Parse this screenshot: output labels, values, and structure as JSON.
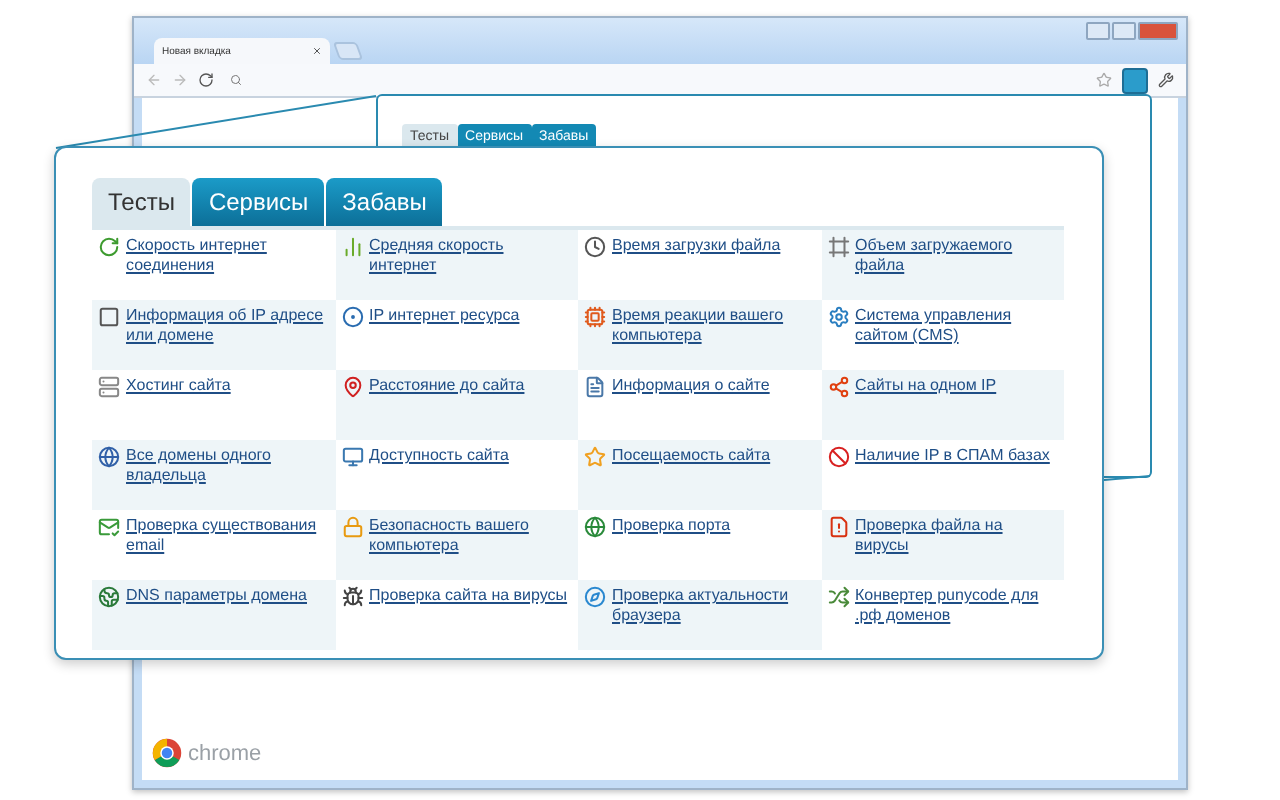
{
  "browser": {
    "tab_title": "Новая вкладка",
    "brand": "chrome"
  },
  "popup_preview": {
    "tabs": [
      {
        "label": "Тесты",
        "selected": true
      },
      {
        "label": "Сервисы",
        "selected": false
      },
      {
        "label": "Забавы",
        "selected": false
      }
    ]
  },
  "popup": {
    "tabs": [
      {
        "label": "Тесты",
        "selected": true
      },
      {
        "label": "Сервисы",
        "selected": false
      },
      {
        "label": "Забавы",
        "selected": false
      }
    ],
    "links": [
      {
        "label": "Скорость интернет соединения"
      },
      {
        "label": "Средняя скорость интернет"
      },
      {
        "label": "Время загрузки файла"
      },
      {
        "label": "Объем загружаемого файла"
      },
      {
        "label": "Информация об IP адресе или домене"
      },
      {
        "label": "IP интернет ресурса"
      },
      {
        "label": "Время реакции вашего компьютера"
      },
      {
        "label": "Система управления сайтом (CMS)"
      },
      {
        "label": "Хостинг сайта"
      },
      {
        "label": "Расстояние до сайта"
      },
      {
        "label": "Информация о сайте"
      },
      {
        "label": "Сайты на одном IP"
      },
      {
        "label": "Все домены одного владельца"
      },
      {
        "label": "Доступность сайта"
      },
      {
        "label": "Посещаемость сайта"
      },
      {
        "label": "Наличие IP в СПАМ базах"
      },
      {
        "label": "Проверка существования email"
      },
      {
        "label": "Безопасность вашего компьютера"
      },
      {
        "label": "Проверка порта"
      },
      {
        "label": "Проверка файла на вирусы"
      },
      {
        "label": "DNS параметры домена"
      },
      {
        "label": "Проверка сайта на вирусы"
      },
      {
        "label": "Проверка актуальности браузера"
      },
      {
        "label": "Конвертер punycode для .рф доменов"
      }
    ]
  }
}
